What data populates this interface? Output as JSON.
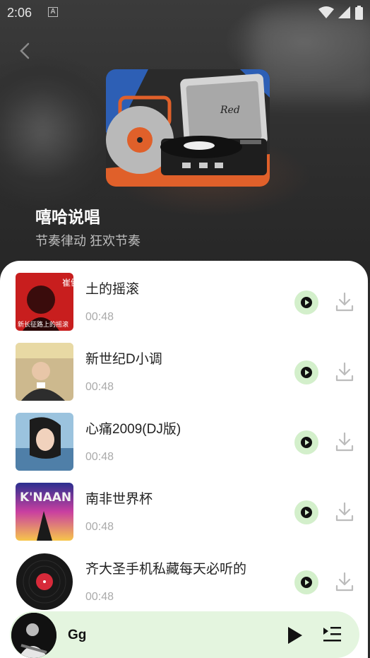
{
  "status_bar": {
    "time": "2:06",
    "indicator": "A",
    "icons": [
      "wifi-icon",
      "signal-icon",
      "battery-icon"
    ]
  },
  "header": {
    "back_icon": "chevron-left-icon",
    "playlist_title": "嘻哈说唱",
    "playlist_subtitle": "节奏律动 狂欢节奏",
    "cover_text": "Red"
  },
  "songs": [
    {
      "title": "土的摇滚",
      "duration": "00:48"
    },
    {
      "title": "新世纪D小调",
      "duration": "00:48"
    },
    {
      "title": "心痛2009(DJ版)",
      "duration": "00:48"
    },
    {
      "title": "南非世界杯",
      "duration": "00:48"
    },
    {
      "title": "齐大圣手机私藏每天必听的",
      "duration": "00:48"
    }
  ],
  "thumb_text": {
    "song0": "崔健",
    "song0_caption": "新长征路上的摇滚",
    "song3": "K'NAAN"
  },
  "mini_player": {
    "title": "Gg",
    "play_icon": "play-icon",
    "queue_icon": "playlist-queue-icon"
  },
  "colors": {
    "play_button_bg": "#d3efcb",
    "mini_player_bg": "#e4f5df",
    "accent_orange": "#e0602a",
    "accent_blue": "#2d5fb5"
  }
}
